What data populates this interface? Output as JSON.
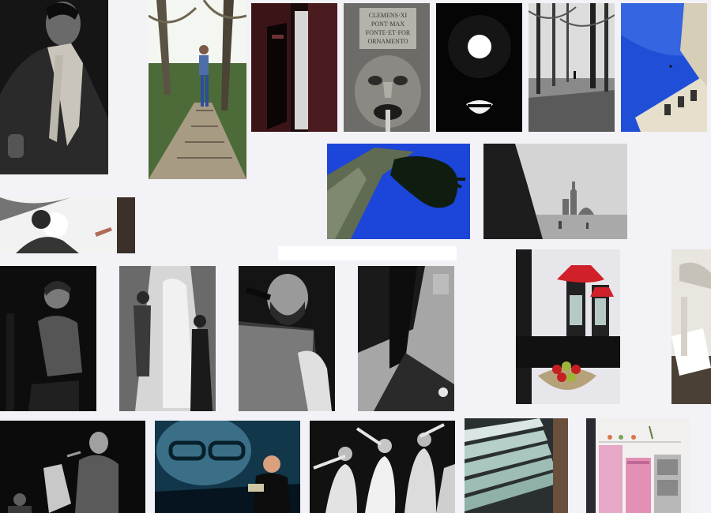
{
  "gallery": {
    "palette": {
      "background": "#f3f2f6",
      "sky_blue": "#1f4fd6",
      "lamp_red": "#d0202a",
      "kitchen_pink": "#e7a7c7"
    },
    "photos": [
      {
        "id": "photo-man-scarf"
      },
      {
        "id": "photo-boardwalk"
      },
      {
        "id": "photo-door-interior"
      },
      {
        "id": "photo-stone-mask",
        "inscription": [
          "CLEMENS·XI",
          "PONT·MAX",
          "FONTE·ET·FOR",
          "ORNAMENTO"
        ]
      },
      {
        "id": "photo-pantheon-oculus"
      },
      {
        "id": "photo-forest-path"
      },
      {
        "id": "photo-blue-sky-building"
      },
      {
        "id": "photo-tree-blue-sky"
      },
      {
        "id": "photo-venice-lagoon"
      },
      {
        "id": "photo-backlit-person"
      },
      {
        "id": "photo-boy-seated"
      },
      {
        "id": "photo-bridal-veil"
      },
      {
        "id": "photo-reader-microphone"
      },
      {
        "id": "photo-shadow-floor"
      },
      {
        "id": "photo-kitchen-red-lamps"
      },
      {
        "id": "photo-white-chair"
      },
      {
        "id": "photo-reading-stage"
      },
      {
        "id": "photo-projection-reader"
      },
      {
        "id": "photo-dancers"
      },
      {
        "id": "photo-glass-stairs"
      },
      {
        "id": "photo-pink-kitchen"
      }
    ]
  }
}
